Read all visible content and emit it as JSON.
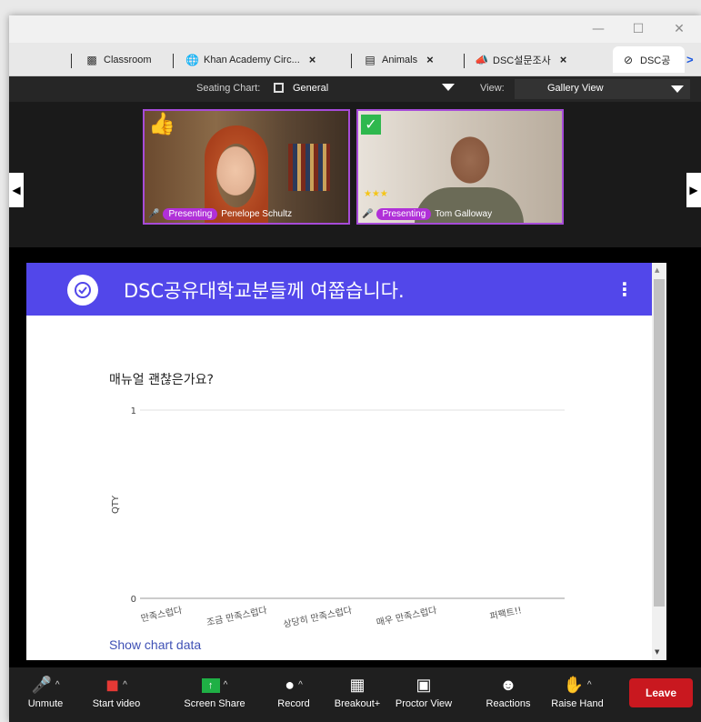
{
  "browser": {
    "tabs": [
      {
        "label": "Classroom",
        "icon": "classroom-icon"
      },
      {
        "label": "Khan Academy Circ...",
        "icon": "globe-icon",
        "close": "×"
      },
      {
        "label": "Animals",
        "icon": "doc-icon",
        "close": "×"
      },
      {
        "label": "DSC설문조사",
        "icon": "megaphone-icon",
        "close": "×"
      },
      {
        "label": "DSC공",
        "icon": "check-circle-icon"
      }
    ],
    "more_tabs": ">",
    "window_controls": {
      "minimize": "—",
      "maximize": "☐",
      "close": "✕"
    }
  },
  "seating": {
    "label": "Seating Chart:",
    "value": "General",
    "view_label": "View:",
    "view_value": "Gallery View"
  },
  "participants": [
    {
      "name": "Penelope Schultz",
      "badge": "Presenting",
      "reaction": "thumbs-up-icon"
    },
    {
      "name": "Tom Galloway",
      "badge": "Presenting",
      "reaction": "check-mark-icon"
    }
  ],
  "form": {
    "title": "DSC공유대학교분들께 여쭙습니다.",
    "question": "매뉴얼 괜찮은가요?",
    "show_chart_data": "Show chart data",
    "accent": "#5247ea"
  },
  "chart_data": {
    "type": "bar",
    "categories": [
      "만족스럽다",
      "조금 만족스럽다",
      "상당히 만족스럽다",
      "매우 만족스럽다",
      "퍼팩트!!"
    ],
    "values": [
      0,
      0,
      0,
      0,
      0
    ],
    "ylabel": "QTY",
    "xlabel": "",
    "ylim": [
      0,
      1
    ],
    "yticks": [
      "0",
      "1"
    ],
    "grid": true
  },
  "toolbar": {
    "unmute": "Unmute",
    "start_video": "Start video",
    "screen_share": "Screen Share",
    "record": "Record",
    "breakout": "Breakout+",
    "proctor": "Proctor View",
    "reactions": "Reactions",
    "raise_hand": "Raise Hand",
    "leave": "Leave",
    "caret": "^"
  }
}
